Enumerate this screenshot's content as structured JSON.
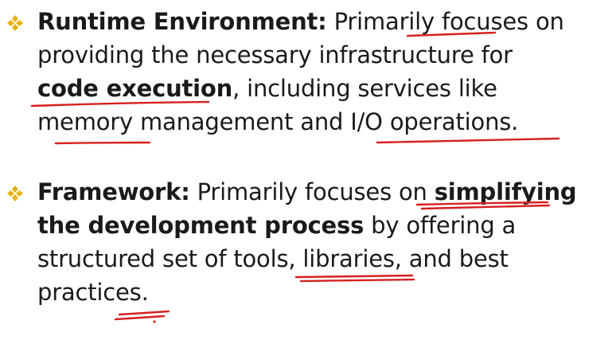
{
  "bullets": [
    {
      "heading": "Runtime Environment:",
      "lines": [
        " Primarily focuses on",
        "providing the necessary infrastructure for",
        ", including services like",
        "memory management and I/O operations."
      ],
      "bold_phrase": "code execution"
    },
    {
      "heading": "Framework:",
      "lines": [
        " Primarily focuses on ",
        " by offering a",
        "structured set of tools, libraries, and best",
        "practices."
      ],
      "bold_phrase_1": "simplifying",
      "bold_phrase_2": "the development process"
    }
  ],
  "colors": {
    "marker": "#e8b10f",
    "ink": "#d62020",
    "text": "#1a1a1a"
  },
  "icons": {
    "marker": "diamond-cluster-bullet-icon"
  }
}
